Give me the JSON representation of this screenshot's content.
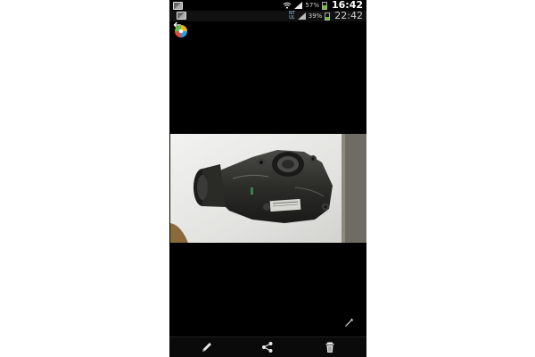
{
  "status_bar_top": {
    "battery_percent_label": "57%",
    "battery_level": 0.57,
    "time": "16:42",
    "icons": [
      "image-notification-icon",
      "wifi-icon",
      "signal-icon",
      "battery-icon"
    ]
  },
  "status_bar_bottom": {
    "network_label_top": "NT",
    "network_label_bottom": "UL",
    "battery_percent_label": "39%",
    "battery_level": 0.39,
    "time": "22:42",
    "icons": [
      "image-notification-icon",
      "network-type-icon",
      "signal-icon",
      "battery-icon"
    ]
  },
  "action_bar": {
    "icons": [
      "back-arrow-icon",
      "gallery-app-icon"
    ]
  },
  "photo": {
    "subject": "photo-of-differential"
  },
  "toolbar": {
    "icons": [
      "edit-pencil-icon",
      "share-icon",
      "delete-trash-icon"
    ]
  },
  "overlay_icons": [
    "magic-wand-icon"
  ],
  "colors": {
    "screen_bg": "#000000",
    "battery_green": "#6ac22e",
    "page_bg": "#ffffff"
  }
}
